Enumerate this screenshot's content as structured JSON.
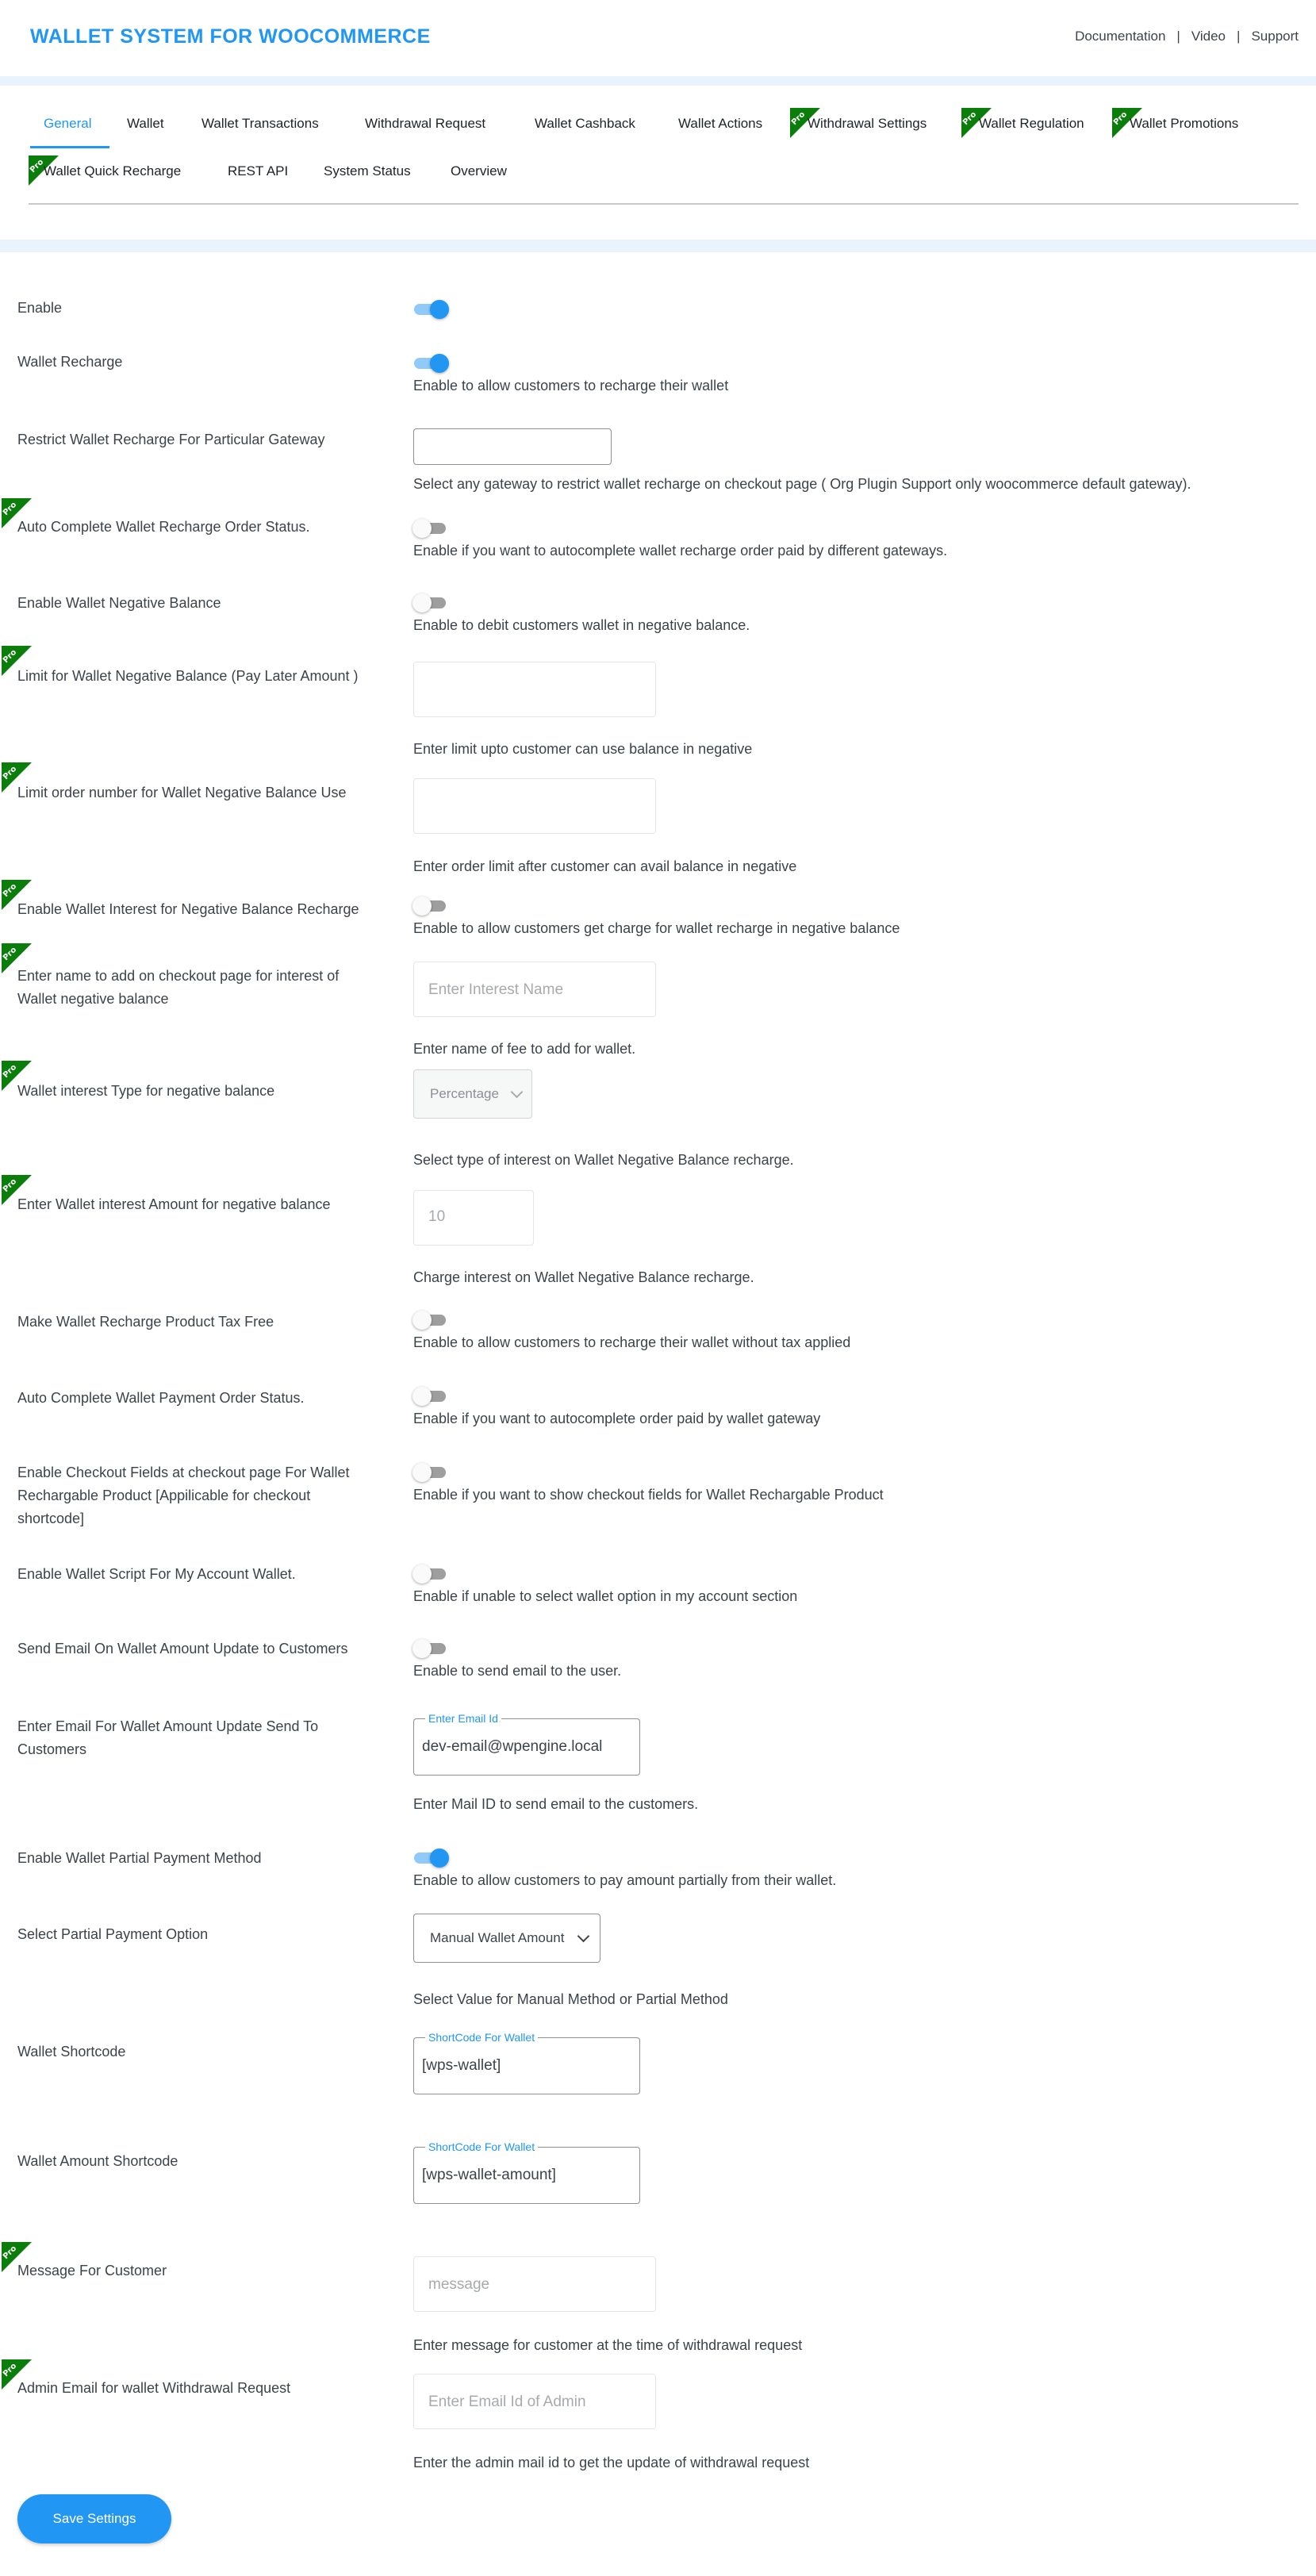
{
  "header": {
    "title": "WALLET SYSTEM FOR WOOCOMMERCE",
    "links": [
      "Documentation",
      "Video",
      "Support"
    ],
    "separator": "|"
  },
  "tabs": [
    {
      "label": "General",
      "active": true,
      "pro": false
    },
    {
      "label": "Wallet",
      "pro": false
    },
    {
      "label": "Wallet Transactions",
      "pro": false
    },
    {
      "label": "Withdrawal Request",
      "pro": false
    },
    {
      "label": "Wallet Cashback",
      "pro": false
    },
    {
      "label": "Wallet Actions",
      "pro": false
    },
    {
      "label": "Withdrawal Settings",
      "pro": true
    },
    {
      "label": "Wallet Regulation",
      "pro": true
    },
    {
      "label": "Wallet Promotions",
      "pro": true
    },
    {
      "label": "Wallet Quick Recharge",
      "pro": true
    },
    {
      "label": "REST API",
      "pro": false
    },
    {
      "label": "System Status",
      "pro": false
    },
    {
      "label": "Overview",
      "pro": false
    }
  ],
  "pro_badge": "Pro",
  "colors": {
    "accent": "#2196f3",
    "pro_badge": "#0a7d0a",
    "band": "#e8f3fd"
  },
  "settings": {
    "enable": {
      "label": "Enable",
      "on": true
    },
    "wallet_recharge": {
      "label": "Wallet Recharge",
      "on": true,
      "desc": "Enable to allow customers to recharge their wallet"
    },
    "restrict_gateway": {
      "label": "Restrict Wallet Recharge For Particular Gateway",
      "value": "",
      "desc": "Select any gateway to restrict wallet recharge on checkout page ( Org Plugin Support only woocommerce default gateway)."
    },
    "auto_complete_recharge": {
      "label": "Auto Complete Wallet Recharge Order Status.",
      "on": false,
      "desc": "Enable if you want to autocomplete wallet recharge order paid by different gateways."
    },
    "negative_balance": {
      "label": "Enable Wallet Negative Balance",
      "on": false,
      "desc": "Enable to debit customers wallet in negative balance."
    },
    "negative_limit": {
      "label": "Limit for Wallet Negative Balance (Pay Later Amount )",
      "value": "",
      "desc": "Enter limit upto customer can use balance in negative"
    },
    "order_limit": {
      "label": "Limit order number for Wallet Negative Balance Use",
      "value": "",
      "desc": "Enter order limit after customer can avail balance in negative"
    },
    "interest_enable": {
      "label": "Enable Wallet Interest for Negative Balance Recharge",
      "on": false,
      "desc": "Enable to allow customers get charge for wallet recharge in negative balance"
    },
    "interest_name": {
      "label": "Enter name to add on checkout page for interest of Wallet negative balance",
      "placeholder": "Enter Interest Name",
      "desc": "Enter name of fee to add for wallet."
    },
    "interest_type": {
      "label": "Wallet interest Type for negative balance",
      "value": "Percentage",
      "desc": "Select type of interest on Wallet Negative Balance recharge."
    },
    "interest_amount": {
      "label": "Enter Wallet interest Amount for negative balance",
      "placeholder": "10",
      "desc": "Charge interest on Wallet Negative Balance recharge."
    },
    "tax_free": {
      "label": "Make Wallet Recharge Product Tax Free",
      "on": false,
      "desc": "Enable to allow customers to recharge their wallet without tax applied"
    },
    "auto_complete_payment": {
      "label": "Auto Complete Wallet Payment Order Status.",
      "on": false,
      "desc": "Enable if you want to autocomplete order paid by wallet gateway"
    },
    "checkout_fields": {
      "label": "Enable Checkout Fields at checkout page For Wallet Rechargable Product [Appilicable for checkout shortcode]",
      "on": false,
      "desc": "Enable if you want to show checkout fields for Wallet Rechargable Product"
    },
    "wallet_script": {
      "label": "Enable Wallet Script For My Account Wallet.",
      "on": false,
      "desc": "Enable if unable to select wallet option in my account section"
    },
    "send_email": {
      "label": "Send Email On Wallet Amount Update to Customers",
      "on": false,
      "desc": "Enable to send email to the user."
    },
    "email_field": {
      "label": "Enter Email For Wallet Amount Update Send To Customers",
      "legend": "Enter Email Id",
      "value": "dev-email@wpengine.local",
      "desc": "Enter Mail ID to send email to the customers."
    },
    "partial_payment": {
      "label": "Enable Wallet Partial Payment Method",
      "on": true,
      "desc": "Enable to allow customers to pay amount partially from their wallet."
    },
    "partial_option": {
      "label": "Select Partial Payment Option",
      "value": "Manual Wallet Amount",
      "desc": "Select Value for Manual Method or Partial Method"
    },
    "wallet_shortcode": {
      "label": "Wallet Shortcode",
      "legend": "ShortCode For Wallet",
      "value": "[wps-wallet]"
    },
    "amount_shortcode": {
      "label": "Wallet Amount Shortcode",
      "legend": "ShortCode For Wallet",
      "value": "[wps-wallet-amount]"
    },
    "customer_message": {
      "label": "Message For Customer",
      "placeholder": "message",
      "desc": "Enter message for customer at the time of withdrawal request"
    },
    "admin_email": {
      "label": "Admin Email for wallet Withdrawal Request",
      "placeholder": "Enter Email Id of Admin",
      "desc": "Enter the admin mail id to get the update of withdrawal request"
    }
  },
  "save_button": "Save Settings"
}
